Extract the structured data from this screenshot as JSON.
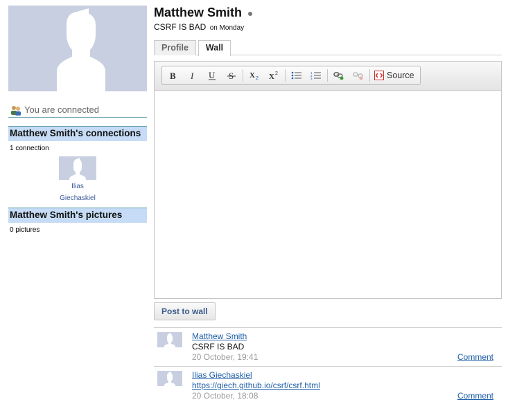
{
  "profile": {
    "name": "Matthew Smith",
    "status": "CSRF IS BAD",
    "status_when": "on Monday"
  },
  "sidebar": {
    "connected_text": "You are connected",
    "connections_heading": "Matthew Smith's connections",
    "connections_count": "1 connection",
    "connections": [
      {
        "name_line1": "Ilias",
        "name_line2": "Giechaskiel"
      }
    ],
    "pictures_heading": "Matthew Smith's pictures",
    "pictures_count": "0 pictures"
  },
  "tabs": [
    {
      "label": "Profile",
      "active": false
    },
    {
      "label": "Wall",
      "active": true
    }
  ],
  "editor": {
    "source_label": "Source",
    "post_button": "Post to wall"
  },
  "posts": [
    {
      "author": "Matthew Smith",
      "text": "CSRF IS BAD",
      "date": "20 October, 19:41",
      "comment_label": "Comment"
    },
    {
      "author": "Ilias Giechaskiel",
      "text": "https://giech.github.io/csrf/csrf.html",
      "date": "20 October, 18:08",
      "comment_label": "Comment"
    }
  ],
  "colors": {
    "avatar_bg": "#c8cfe0",
    "section_bg": "#c6dcf6",
    "link": "#1f5fa8"
  }
}
